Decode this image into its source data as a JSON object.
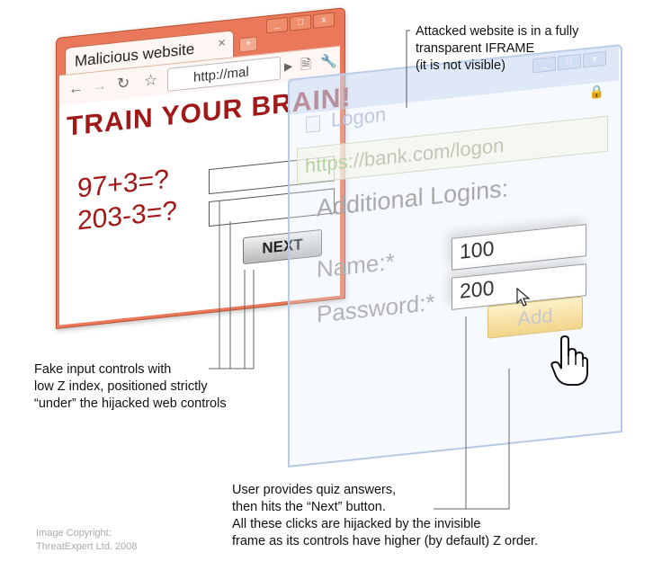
{
  "malicious_window": {
    "tab_title": "Malicious website",
    "tab_close": "×",
    "new_tab": "+",
    "window_buttons": [
      "_",
      "□",
      "x"
    ],
    "url": "http://mal",
    "heading": "TRAIN YOUR BRAIN!",
    "question1": "97+3=?",
    "question2": "203-3=?",
    "next_label": "NEXT"
  },
  "bank_iframe": {
    "title": "Logon",
    "url_scheme": "https",
    "url_rest": "://bank.com/logon",
    "window_buttons": [
      "_",
      "□",
      "x"
    ],
    "heading": "Additional Logins:",
    "name_label": "Name:*",
    "name_value": "100",
    "password_label": "Password:*",
    "password_value": "200",
    "add_label": "Add"
  },
  "annotations": {
    "iframe_note": [
      "Attacked website is in a fully",
      "transparent IFRAME",
      "(it is not visible)"
    ],
    "fake_controls_note": [
      "Fake input controls with",
      "low Z index, positioned strictly",
      "“under” the hijacked web controls"
    ],
    "clicks_note": [
      "User provides quiz answers,",
      "then hits the “Next” button.",
      "All these clicks are hijacked by the invisible",
      "frame as its controls have higher (by default) Z order."
    ]
  },
  "copyright": [
    "Image Copyright:",
    "ThreatExpert Ltd. 2008"
  ]
}
